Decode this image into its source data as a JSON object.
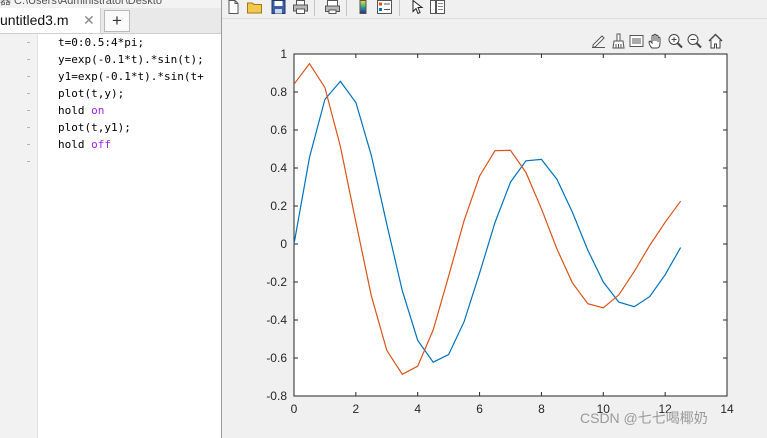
{
  "editor": {
    "path": "器   C:\\Users\\Administrator\\Deskto",
    "file_tab": "untitled3.m",
    "close_glyph": "✕",
    "new_tab_glyph": "+",
    "lines": [
      [
        {
          "t": "t=0:0.5:4*pi;"
        }
      ],
      [
        {
          "t": "y=exp(-0.1*t).*sin(t);"
        }
      ],
      [
        {
          "t": "y1=exp(-0.1*t).*sin(t+"
        }
      ],
      [
        {
          "t": "plot(t,y);"
        }
      ],
      [
        {
          "t": "hold "
        },
        {
          "t": "on",
          "kw": true
        }
      ],
      [
        {
          "t": "plot(t,y1);"
        }
      ],
      [
        {
          "t": "hold "
        },
        {
          "t": "off",
          "kw": true
        }
      ]
    ]
  },
  "figure_toolbar": {
    "icons": [
      "new-figure-icon",
      "open-file-icon",
      "save-icon",
      "print-icon",
      "print-preview-icon",
      "colorbar-icon",
      "legend-icon",
      "pointer-icon",
      "property-inspector-icon"
    ]
  },
  "axes_toolbar": {
    "icons": [
      "edit-plot-icon",
      "brush-icon",
      "data-tips-icon",
      "pan-icon",
      "zoom-in-icon",
      "zoom-out-icon",
      "home-icon"
    ]
  },
  "watermark": "CSDN @七七喝椰奶",
  "colors": {
    "series1": "#0072bd",
    "series2": "#d95319"
  },
  "chart_data": {
    "type": "line",
    "xlim": [
      0,
      14
    ],
    "ylim": [
      -0.8,
      1
    ],
    "xticks": [
      0,
      2,
      4,
      6,
      8,
      10,
      12,
      14
    ],
    "yticks": [
      -0.8,
      -0.6,
      -0.4,
      -0.2,
      0,
      0.2,
      0.4,
      0.6,
      0.8,
      1
    ],
    "xtick_labels": [
      "0",
      "2",
      "4",
      "6",
      "8",
      "10",
      "12",
      "14"
    ],
    "ytick_labels": [
      "-0.8",
      "-0.6",
      "-0.4",
      "-0.2",
      "0",
      "0.2",
      "0.4",
      "0.6",
      "0.8",
      "1"
    ],
    "grid": false,
    "series": [
      {
        "color": "#0072bd",
        "x": [
          0,
          0.5,
          1,
          1.5,
          2,
          2.5,
          3,
          3.5,
          4,
          4.5,
          5,
          5.5,
          6,
          6.5,
          7,
          7.5,
          8,
          8.5,
          9,
          9.5,
          10,
          10.5,
          11,
          11.5,
          12,
          12.5
        ],
        "y": [
          0,
          0.456,
          0.761,
          0.856,
          0.744,
          0.467,
          0.104,
          -0.246,
          -0.507,
          -0.622,
          -0.582,
          -0.409,
          -0.153,
          0.113,
          0.326,
          0.438,
          0.445,
          0.341,
          0.167,
          -0.032,
          -0.2,
          -0.306,
          -0.33,
          -0.277,
          -0.162,
          -0.019
        ]
      },
      {
        "color": "#d95319",
        "x": [
          0,
          0.5,
          1,
          1.5,
          2,
          2.5,
          3,
          3.5,
          4,
          4.5,
          5,
          5.5,
          6,
          6.5,
          7,
          7.5,
          8,
          8.5,
          9,
          9.5,
          10,
          10.5,
          11,
          11.5,
          12,
          12.5
        ],
        "y": [
          0.841,
          0.949,
          0.823,
          0.513,
          0.115,
          -0.272,
          -0.56,
          -0.686,
          -0.643,
          -0.452,
          -0.17,
          0.123,
          0.358,
          0.491,
          0.493,
          0.376,
          0.186,
          -0.026,
          -0.204,
          -0.314,
          -0.336,
          -0.268,
          -0.145,
          -0.008,
          0.114,
          0.225
        ]
      }
    ]
  }
}
